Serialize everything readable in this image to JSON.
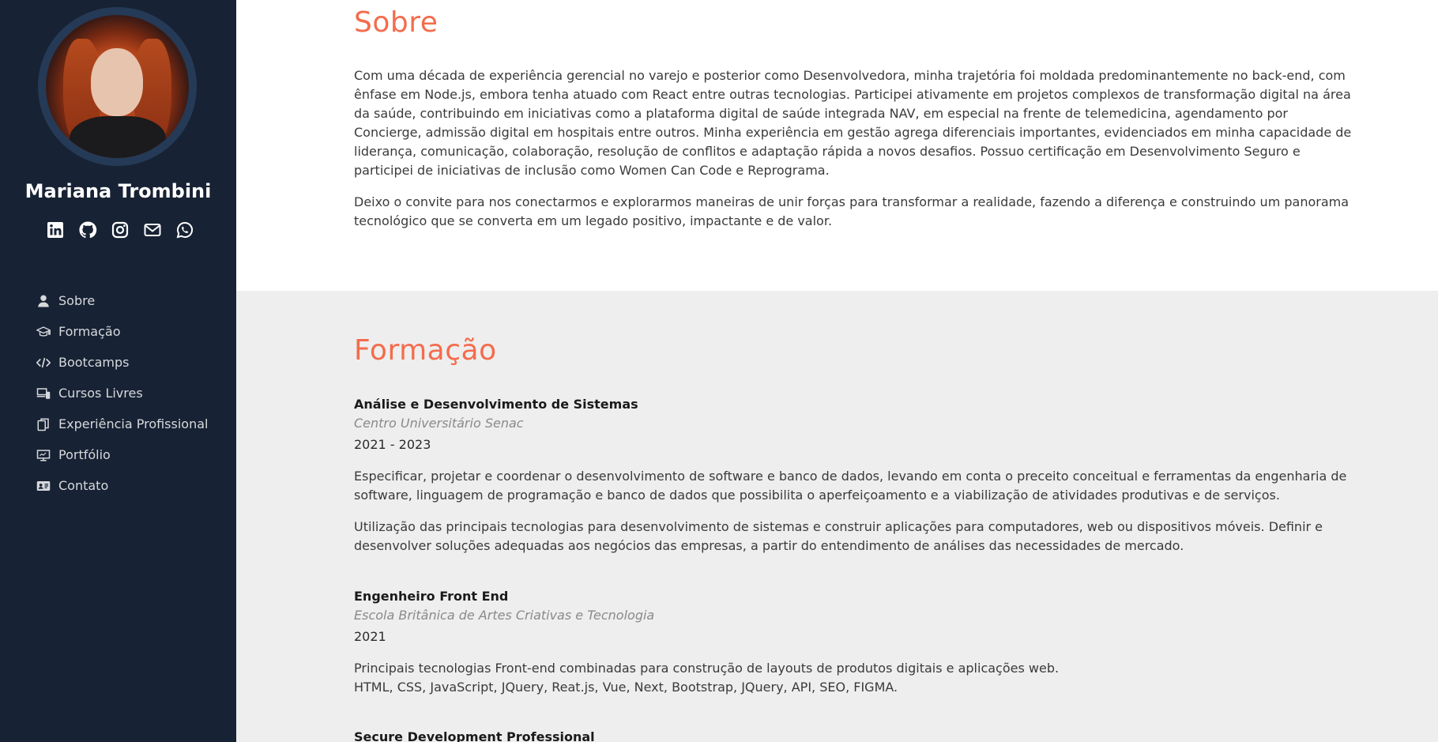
{
  "sidebar": {
    "name": "Mariana Trombini",
    "social_icons": [
      "linkedin-icon",
      "github-icon",
      "instagram-icon",
      "mail-icon",
      "whatsapp-icon"
    ],
    "nav": [
      {
        "label": "Sobre",
        "icon": "user-icon"
      },
      {
        "label": "Formação",
        "icon": "graduation-cap-icon"
      },
      {
        "label": "Bootcamps",
        "icon": "code-icon"
      },
      {
        "label": "Cursos Livres",
        "icon": "laptop-phone-icon"
      },
      {
        "label": "Experiência Profissional",
        "icon": "clipboard-icon"
      },
      {
        "label": "Portfólio",
        "icon": "presentation-icon"
      },
      {
        "label": "Contato",
        "icon": "contact-card-icon"
      }
    ]
  },
  "sobre": {
    "title": "Sobre",
    "p1": "Com uma década de experiência gerencial no varejo e posterior como Desenvolvedora, minha trajetória foi moldada predominantemente no back-end, com ênfase em Node.js, embora tenha atuado com React entre outras tecnologias. Participei ativamente em projetos complexos de transformação digital na área da saúde, contribuindo em iniciativas como a plataforma digital de saúde integrada NAV, em especial na frente de telemedicina, agendamento por Concierge, admissão digital em hospitais entre outros. Minha experiência em gestão agrega diferenciais importantes, evidenciados em minha capacidade de liderança, comunicação, colaboração, resolução de conflitos e adaptação rápida a novos desafios. Possuo certificação em Desenvolvimento Seguro e participei de iniciativas de inclusão como Women Can Code e Reprograma.",
    "p2": "Deixo o convite para nos conectarmos e explorarmos maneiras de unir forças para transformar a realidade, fazendo a diferença e construindo um panorama tecnológico que se converta em um legado positivo, impactante e de valor."
  },
  "formacao": {
    "title": "Formação",
    "courses": [
      {
        "title": "Análise e Desenvolvimento de Sistemas",
        "institution": "Centro Universitário Senac",
        "years": "2021 - 2023",
        "desc1": "Especificar, projetar e coordenar o desenvolvimento de software e banco de dados, levando em conta o preceito conceitual e ferramentas da engenharia de software, linguagem de programação e banco de dados que possibilita o aperfeiçoamento e a viabilização de atividades produtivas e de serviços.",
        "desc2": "Utilização das principais tecnologias para desenvolvimento de sistemas e construir aplicações para computadores, web ou dispositivos móveis. Definir e desenvolver soluções adequadas aos negócios das empresas, a partir do entendimento de análises das necessidades de mercado."
      },
      {
        "title": "Engenheiro Front End",
        "institution": "Escola Britânica de Artes Criativas e Tecnologia",
        "years": "2021",
        "desc1": "Principais tecnologias Front-end combinadas para construção de layouts de produtos digitais e aplicações web.",
        "desc2": "HTML, CSS, JavaScript, JQuery, Reat.js, Vue, Next, Bootstrap, JQuery, API, SEO, FIGMA."
      },
      {
        "title": "Secure Development Professional"
      }
    ]
  }
}
